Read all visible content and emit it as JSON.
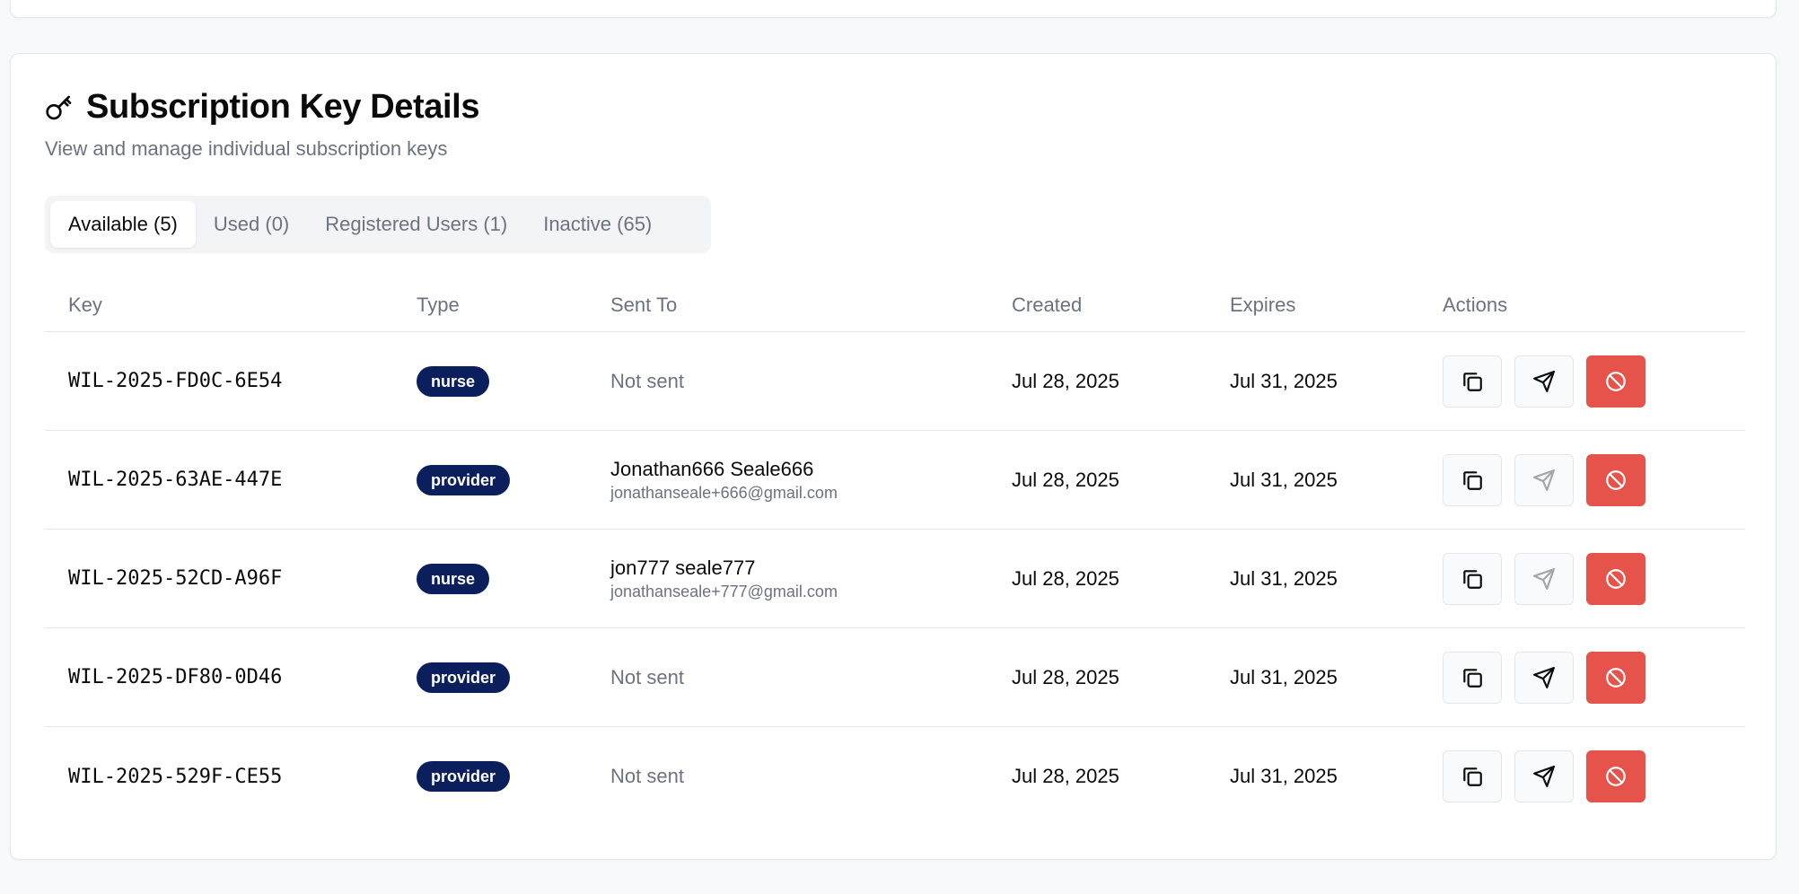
{
  "header": {
    "title": "Subscription Key Details",
    "subtitle": "View and manage individual subscription keys"
  },
  "tabs": [
    {
      "label": "Available (5)",
      "active": true
    },
    {
      "label": "Used (0)",
      "active": false
    },
    {
      "label": "Registered Users (1)",
      "active": false
    },
    {
      "label": "Inactive (65)",
      "active": false
    }
  ],
  "table": {
    "columns": [
      "Key",
      "Type",
      "Sent To",
      "Created",
      "Expires",
      "Actions"
    ],
    "rows": [
      {
        "key": "WIL-2025-FD0C-6E54",
        "type": "nurse",
        "sent_name": "Not sent",
        "sent_email": "",
        "created": "Jul 28, 2025",
        "expires": "Jul 31, 2025",
        "send_enabled": true
      },
      {
        "key": "WIL-2025-63AE-447E",
        "type": "provider",
        "sent_name": "Jonathan666 Seale666",
        "sent_email": "jonathanseale+666@gmail.com",
        "created": "Jul 28, 2025",
        "expires": "Jul 31, 2025",
        "send_enabled": false
      },
      {
        "key": "WIL-2025-52CD-A96F",
        "type": "nurse",
        "sent_name": "jon777 seale777",
        "sent_email": "jonathanseale+777@gmail.com",
        "created": "Jul 28, 2025",
        "expires": "Jul 31, 2025",
        "send_enabled": false
      },
      {
        "key": "WIL-2025-DF80-0D46",
        "type": "provider",
        "sent_name": "Not sent",
        "sent_email": "",
        "created": "Jul 28, 2025",
        "expires": "Jul 31, 2025",
        "send_enabled": true
      },
      {
        "key": "WIL-2025-529F-CE55",
        "type": "provider",
        "sent_name": "Not sent",
        "sent_email": "",
        "created": "Jul 28, 2025",
        "expires": "Jul 31, 2025",
        "send_enabled": true
      }
    ]
  },
  "icons": {
    "title": "key-icon",
    "copy": "copy-icon",
    "send": "send-icon",
    "revoke": "ban-icon"
  },
  "colors": {
    "badge": "#0b1f5c",
    "danger": "#e5534b",
    "muted_text": "#6b7280"
  }
}
